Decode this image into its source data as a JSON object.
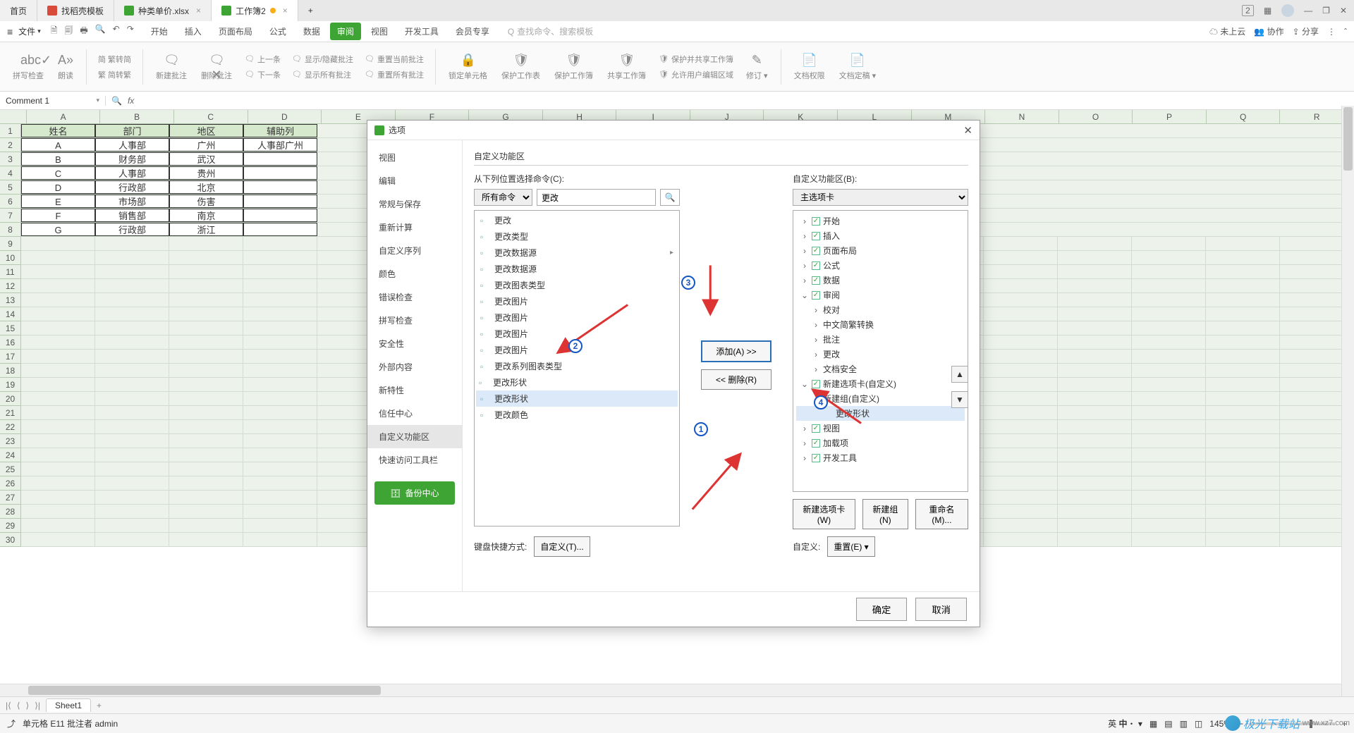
{
  "titlebar": {
    "tabs": [
      {
        "label": "首页",
        "icon": "home"
      },
      {
        "label": "找稻壳模板",
        "icon": "red"
      },
      {
        "label": "种类单价.xlsx",
        "icon": "green"
      },
      {
        "label": "工作簿2",
        "icon": "green",
        "active": true,
        "dirty": true
      }
    ],
    "plus": "+",
    "right_icons": [
      "[2]",
      "grid",
      "user",
      "—",
      "❐",
      "✕"
    ]
  },
  "menubar": {
    "file": "文件",
    "quick_icons": [
      "save",
      "save2",
      "print",
      "preview",
      "undo",
      "redo"
    ],
    "items": [
      "开始",
      "插入",
      "页面布局",
      "公式",
      "数据",
      "审阅",
      "视图",
      "开发工具",
      "会员专享"
    ],
    "active": "审阅",
    "search_placeholder": "查找命令、搜索模板",
    "search_prefix": "Q",
    "right": {
      "cloud": "未上云",
      "coop": "协作",
      "share": "分享"
    }
  },
  "ribbon": {
    "groups": [
      {
        "big": "拼写检查",
        "icon": "abc"
      },
      {
        "big": "朗读",
        "icon": "A»"
      },
      {
        "stack": [
          "简 繁转简",
          "繁 简转繁"
        ]
      },
      {
        "big": "新建批注",
        "icon": "+"
      },
      {
        "big": "删除批注",
        "icon": "×"
      },
      {
        "stack": [
          "上一条",
          "下一条"
        ],
        "icons": [
          "⟨",
          "⟩"
        ]
      },
      {
        "stack": [
          "显示/隐藏批注",
          "显示所有批注"
        ]
      },
      {
        "stack": [
          "重置当前批注",
          "重置所有批注"
        ]
      },
      {
        "big": "锁定单元格"
      },
      {
        "big": "保护工作表"
      },
      {
        "big": "保护工作簿"
      },
      {
        "big": "共享工作簿"
      },
      {
        "stack": [
          "保护并共享工作簿",
          "允许用户编辑区域"
        ]
      },
      {
        "big": "修订",
        "drop": true
      },
      {
        "big": "文档权限"
      },
      {
        "big": "文档定稿",
        "drop": true
      }
    ]
  },
  "namebox": {
    "value": "Comment 1",
    "fx": "fx"
  },
  "columns": [
    "A",
    "B",
    "C",
    "D",
    "E",
    "F",
    "G",
    "H",
    "I",
    "J",
    "K",
    "L",
    "M",
    "N",
    "O",
    "P",
    "Q",
    "R"
  ],
  "row_count": 30,
  "table": {
    "headers": [
      "姓名",
      "部门",
      "地区",
      "辅助列"
    ],
    "rows": [
      [
        "A",
        "人事部",
        "广州",
        "人事部广州"
      ],
      [
        "B",
        "财务部",
        "武汉",
        ""
      ],
      [
        "C",
        "人事部",
        "贵州",
        ""
      ],
      [
        "D",
        "行政部",
        "北京",
        ""
      ],
      [
        "E",
        "市场部",
        "伤害",
        ""
      ],
      [
        "F",
        "销售部",
        "南京",
        ""
      ],
      [
        "G",
        "行政部",
        "浙江",
        ""
      ]
    ]
  },
  "sheetbar": {
    "sheet": "Sheet1",
    "plus": "+"
  },
  "statusbar": {
    "left_icon": "⤴",
    "cell_info": "单元格 E11 批注者 admin",
    "ime": "英 中",
    "zoom": "145%",
    "minus": "−",
    "plus": "+"
  },
  "dialog": {
    "title": "选项",
    "side": [
      "视图",
      "编辑",
      "常规与保存",
      "重新计算",
      "自定义序列",
      "颜色",
      "错误检查",
      "拼写检查",
      "安全性",
      "外部内容",
      "新特性",
      "信任中心",
      "自定义功能区",
      "快速访问工具栏"
    ],
    "side_active": "自定义功能区",
    "backup": "备份中心",
    "section": "自定义功能区",
    "left_label": "从下列位置选择命令(C):",
    "left_combo": "所有命令",
    "search_value": "更改",
    "commands": [
      "更改",
      "更改类型",
      "更改数据源",
      "更改数据源",
      "更改图表类型",
      "更改图片",
      "更改图片",
      "更改图片",
      "更改图片",
      "更改系列图表类型",
      "更改形状",
      "更改形状",
      "更改颜色"
    ],
    "cmd_selected_index": 11,
    "mid": {
      "add": "添加(A) >>",
      "remove": "<< 删除(R)"
    },
    "right_label": "自定义功能区(B):",
    "right_combo": "主选项卡",
    "tree": [
      {
        "lvl": 1,
        "chk": true,
        "arrow": ">",
        "label": "开始"
      },
      {
        "lvl": 1,
        "chk": true,
        "arrow": ">",
        "label": "插入"
      },
      {
        "lvl": 1,
        "chk": true,
        "arrow": ">",
        "label": "页面布局"
      },
      {
        "lvl": 1,
        "chk": true,
        "arrow": ">",
        "label": "公式"
      },
      {
        "lvl": 1,
        "chk": true,
        "arrow": ">",
        "label": "数据"
      },
      {
        "lvl": 1,
        "chk": true,
        "arrow": "v",
        "label": "审阅"
      },
      {
        "lvl": 2,
        "arrow": ">",
        "label": "校对"
      },
      {
        "lvl": 2,
        "arrow": ">",
        "label": "中文简繁转换"
      },
      {
        "lvl": 2,
        "arrow": ">",
        "label": "批注"
      },
      {
        "lvl": 2,
        "arrow": ">",
        "label": "更改"
      },
      {
        "lvl": 2,
        "arrow": ">",
        "label": "文档安全"
      },
      {
        "lvl": 1,
        "chk": true,
        "arrow": "v",
        "label": "新建选项卡(自定义)"
      },
      {
        "lvl": 2,
        "arrow": "v",
        "label": "新建组(自定义)"
      },
      {
        "lvl": 3,
        "label": "更改形状",
        "sel": true
      },
      {
        "lvl": 1,
        "chk": true,
        "arrow": ">",
        "label": "视图"
      },
      {
        "lvl": 1,
        "chk": true,
        "arrow": ">",
        "label": "加载项"
      },
      {
        "lvl": 1,
        "chk": true,
        "arrow": ">",
        "label": "开发工具"
      }
    ],
    "bottom": {
      "new_tab": "新建选项卡(W)",
      "new_group": "新建组(N)",
      "rename": "重命名(M)..."
    },
    "kb_label": "键盘快捷方式:",
    "kb_btn": "自定义(T)...",
    "reset_label": "自定义:",
    "reset_btn": "重置(E)",
    "ok": "确定",
    "cancel": "取消"
  },
  "watermark": {
    "brand": "极光下载站",
    "url": "www.xz7.com"
  }
}
